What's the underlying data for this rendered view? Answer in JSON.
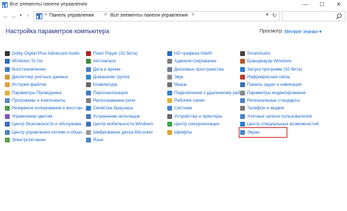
{
  "window": {
    "title": "Все элементы панели управления",
    "min_symbol": "—",
    "max_symbol": "☐",
    "close_symbol": "✕"
  },
  "nav": {
    "back_symbol": "←",
    "forward_symbol": "→",
    "recent_symbol": "▼",
    "up_symbol": "↑"
  },
  "address": {
    "crumbs": [
      "Панель управления",
      "Все элементы панели управления"
    ],
    "separator": ">",
    "refresh_symbol": "↻"
  },
  "search": {
    "placeholder": ""
  },
  "header": {
    "title": "Настройка параметров компьютера",
    "view_label": "Просмотр:",
    "view_value": "Мелкие значки ▾"
  },
  "colors": {
    "link": "#1a66cc",
    "heading": "#1e3287",
    "highlight": "#d21f1f"
  },
  "columns": [
    [
      {
        "label": "Dolby Digital Plus Advanced Audio",
        "icon": "audio-icon",
        "color": "#333333"
      },
      {
        "label": "Windows To Go",
        "icon": "windows-to-go-icon",
        "color": "#2a6dbf"
      },
      {
        "label": "Восстановление",
        "icon": "recovery-icon",
        "color": "#3b7fc4"
      },
      {
        "label": "Диспетчер учетных данных",
        "icon": "credentials-icon",
        "color": "#c99a2e"
      },
      {
        "label": "История файлов",
        "icon": "file-history-icon",
        "color": "#d8a43a"
      },
      {
        "label": "Параметры Проводника",
        "icon": "folder-options-icon",
        "color": "#e2b33c"
      },
      {
        "label": "Программы и компоненты",
        "icon": "programs-icon",
        "color": "#5a87c6"
      },
      {
        "label": "Резервное копирование и восстан...",
        "icon": "backup-icon",
        "color": "#4f9a4a"
      },
      {
        "label": "Управление цветом",
        "icon": "color-management-icon",
        "color": "#7a5bc2"
      },
      {
        "label": "Центр безопасности и обслужива...",
        "icon": "security-center-icon",
        "color": "#3a6fc0"
      },
      {
        "label": "Центр управления сетями и общи...",
        "icon": "network-center-icon",
        "color": "#4a86c8"
      },
      {
        "label": "Электропитание",
        "icon": "power-icon",
        "color": "#5aa048"
      }
    ],
    [
      {
        "label": "Flash Player (32 бита)",
        "icon": "flash-icon",
        "color": "#b01e1e"
      },
      {
        "label": "Автозапуск",
        "icon": "autoplay-icon",
        "color": "#3f8d3f"
      },
      {
        "label": "Дата и время",
        "icon": "date-time-icon",
        "color": "#4a7fc4"
      },
      {
        "label": "Домашняя группа",
        "icon": "homegroup-icon",
        "color": "#2e8bc9"
      },
      {
        "label": "Клавиатура",
        "icon": "keyboard-icon",
        "color": "#666666"
      },
      {
        "label": "Персонализация",
        "icon": "personalization-icon",
        "color": "#3d7cc9"
      },
      {
        "label": "Распознавание речи",
        "icon": "speech-icon",
        "color": "#808080"
      },
      {
        "label": "Свойства браузера",
        "icon": "browser-icon",
        "color": "#2f7bd1"
      },
      {
        "label": "Устранение неполадок",
        "icon": "troubleshooting-icon",
        "color": "#5078b4"
      },
      {
        "label": "Центр мобильности Windows",
        "icon": "mobility-center-icon",
        "color": "#3d6fb8"
      },
      {
        "label": "Шифрование диска BitLocker",
        "icon": "bitlocker-icon",
        "color": "#9a9a9a"
      },
      {
        "label": "Язык",
        "icon": "language-icon",
        "color": "#4a86c8"
      }
    ],
    [
      {
        "label": "HD-графика Intel®",
        "icon": "intel-graphics-icon",
        "color": "#1f6fbf"
      },
      {
        "label": "Администрирование",
        "icon": "admin-tools-icon",
        "color": "#7d7d7d"
      },
      {
        "label": "Дисковые пространства",
        "icon": "storage-spaces-icon",
        "color": "#6f7f95"
      },
      {
        "label": "Звук",
        "icon": "sound-icon",
        "color": "#8a8a8a"
      },
      {
        "label": "Мышь",
        "icon": "mouse-icon",
        "color": "#707070"
      },
      {
        "label": "Подключения к удаленному рабоч...",
        "icon": "remote-app-icon",
        "color": "#3b7fc4"
      },
      {
        "label": "Рабочие папки",
        "icon": "work-folders-icon",
        "color": "#e2b33c"
      },
      {
        "label": "Система",
        "icon": "system-icon",
        "color": "#4a86c8"
      },
      {
        "label": "Устройства и принтеры",
        "icon": "devices-printers-icon",
        "color": "#6b6b6b"
      },
      {
        "label": "Центр синхронизации",
        "icon": "sync-center-icon",
        "color": "#3fa34d"
      },
      {
        "label": "Шрифты",
        "icon": "fonts-icon",
        "color": "#d9a93a"
      }
    ],
    [
      {
        "label": "SmartAudio",
        "icon": "smartaudio-icon",
        "color": "#444444"
      },
      {
        "label": "Брандмауэр Windows",
        "icon": "firewall-icon",
        "color": "#b5582a"
      },
      {
        "label": "Запуск программ (32 бита)",
        "icon": "startup-icon",
        "color": "#2f7bd1"
      },
      {
        "label": "Инфракрасная связь",
        "icon": "infrared-icon",
        "color": "#c0392b"
      },
      {
        "label": "Панель задач и навигация",
        "icon": "taskbar-icon",
        "color": "#3d6fb8"
      },
      {
        "label": "Параметры индексирования",
        "icon": "indexing-icon",
        "color": "#8a8a8a"
      },
      {
        "label": "Региональные стандарты",
        "icon": "region-icon",
        "color": "#4a86c8"
      },
      {
        "label": "Телефон и модем",
        "icon": "phone-modem-icon",
        "color": "#7a7a7a"
      },
      {
        "label": "Учетные записи пользователей",
        "icon": "user-accounts-icon",
        "color": "#4a86c8"
      },
      {
        "label": "Центр специальных возможностей",
        "icon": "ease-of-access-icon",
        "color": "#2f7bd1"
      },
      {
        "label": "Экран",
        "icon": "display-icon",
        "color": "#4a86c8",
        "selected": true
      }
    ]
  ]
}
